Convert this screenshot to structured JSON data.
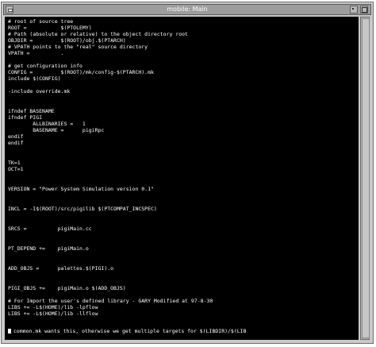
{
  "window": {
    "title": "mobile: Main"
  },
  "terminal": {
    "lines": [
      "# root of source tree",
      "ROOT =           $(PTOLEMY)",
      "# Path (absolute or relative) to the object directory root",
      "OBJDIR =         $(ROOT)/obj.$(PTARCH)",
      "# VPATH points to the \"real\" source directory",
      "VPATH =          .",
      "",
      "# get configuration info",
      "CONFIG =         $(ROOT)/mk/config-$(PTARCH).mk",
      "include $(CONFIG)",
      "",
      "-include override.mk",
      "",
      "ifndef BASENAME",
      "ifndef PIGI",
      "        ALLBINARIES =   1",
      "        BASENAME =      pigiRpc",
      "endif",
      "endif",
      "",
      "TK=1",
      "OCT=1",
      "",
      "VERSION = \"Power System Simulation version 0.1\"",
      "",
      "INCL = -I$(ROOT)/src/pigilib $(PTCOMPAT_INCSPEC)",
      "",
      "SRCS =          pigiMain.cc",
      "",
      "PT_DEPEND +=    pigiMain.o",
      "",
      "ADD_OBJS =      palettes.$(PIGI).o",
      "",
      "PIGI_OBJS +=    pigiMain.o $(ADD_OBJS)",
      "",
      "# For Import the user's defined library - GARY Modified at 97-8-30",
      "LIBS += -L$(HOME)/lib -lpflow",
      "LIBS += -L$(HOME)/lib -llflow",
      "",
      "common.mk wants this, otherwise we get multiple targets for $(LIBDIR)/$(LIB"
    ]
  }
}
